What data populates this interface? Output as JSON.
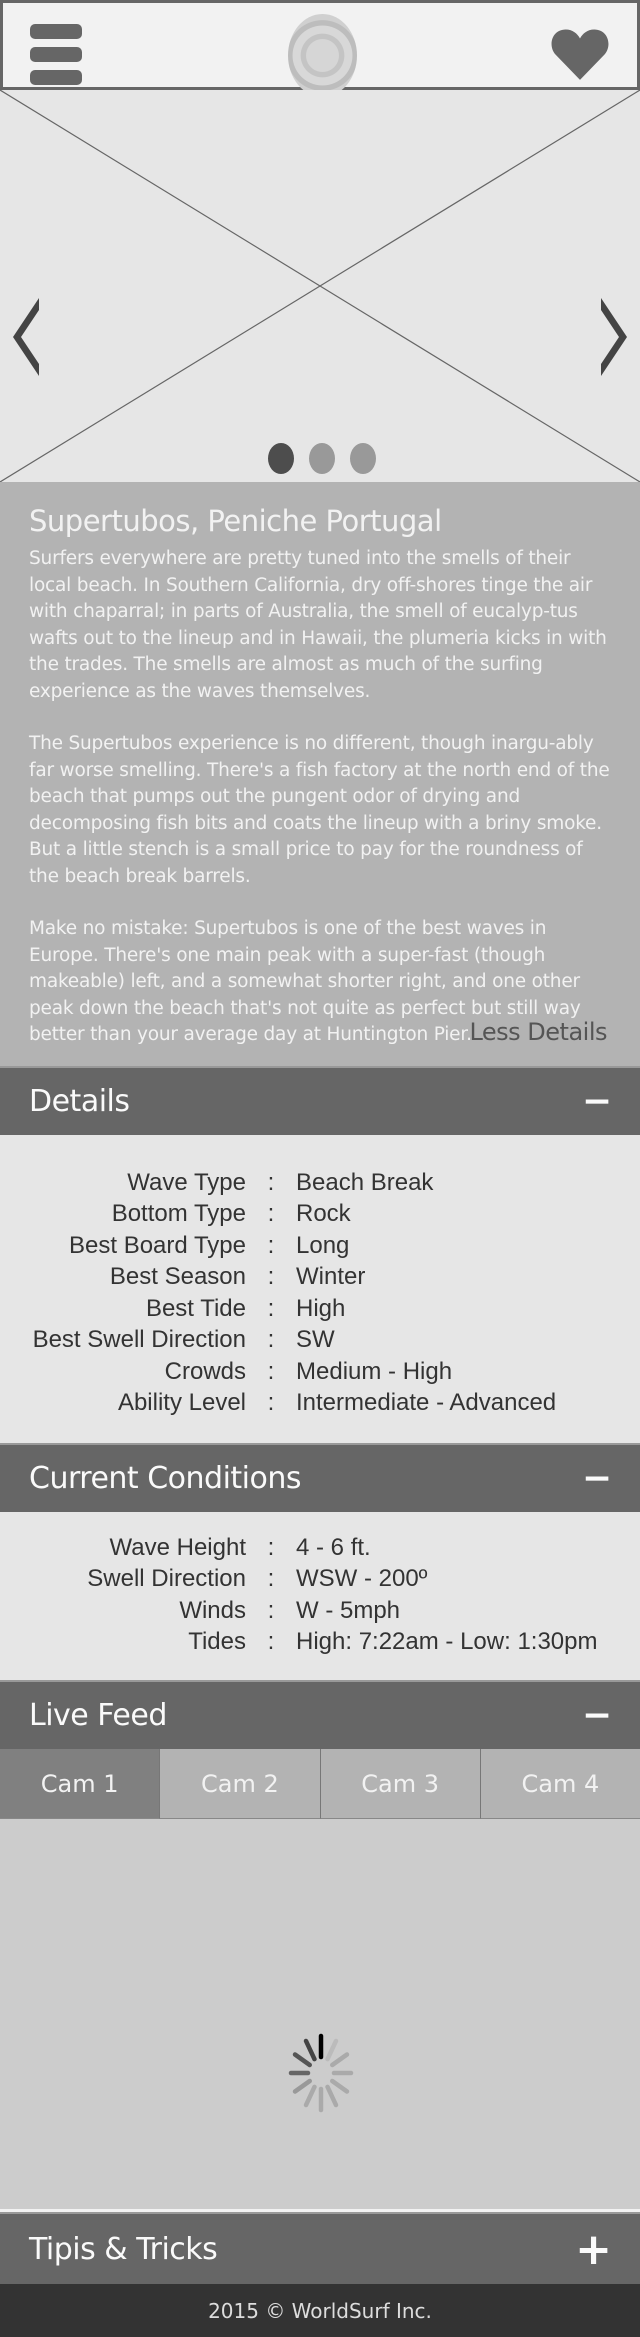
{
  "header": {
    "menu_icon": "hamburger-menu-icon",
    "logo": "wave-logo",
    "favorite_icon": "heart-icon"
  },
  "carousel": {
    "slide_count": 3,
    "active_slide": 1,
    "prev_icon": "chevron-left-icon",
    "next_icon": "chevron-right-icon"
  },
  "spot": {
    "title": "Supertubos, Peniche Portugal",
    "paragraphs": [
      "Surfers everywhere are pretty tuned into the smells of their local beach. In Southern California, dry off-shores tinge the air with chaparral; in parts of Australia, the smell of eucalyp-tus wafts out to the lineup and in Hawaii, the plumeria kicks in with the trades. The smells are almost as much of the surfing experience as the waves themselves.",
      "The Supertubos experience is no different, though inargu-ably far worse smelling. There's a fish factory at the north end of the beach that pumps out the pungent odor of drying and decomposing fish bits and coats the lineup with a briny smoke. But a little stench is a small price to pay for the roundness of the beach break barrels.",
      "Make no mistake: Supertubos is one of the best waves in Europe. There's one main peak with a super-fast (though makeable) left, and a somewhat shorter right, and one other peak down the beach that's not quite as perfect but still way better than your average day at Huntington Pier."
    ],
    "less_details": "Less Details"
  },
  "details": {
    "title": "Details",
    "toggle": "−",
    "separator": ":",
    "rows": [
      {
        "label": "Wave Type",
        "value": "Beach Break"
      },
      {
        "label": "Bottom Type",
        "value": "Rock"
      },
      {
        "label": "Best Board Type",
        "value": "Long"
      },
      {
        "label": "Best Season",
        "value": "Winter"
      },
      {
        "label": "Best Tide",
        "value": "High"
      },
      {
        "label": "Best Swell Direction",
        "value": "SW"
      },
      {
        "label": "Crowds",
        "value": "Medium - High"
      },
      {
        "label": "Ability Level",
        "value": "Intermediate - Advanced"
      }
    ]
  },
  "conditions": {
    "title": "Current Conditions",
    "toggle": "−",
    "separator": ":",
    "rows": [
      {
        "label": "Wave Height",
        "value": "4 - 6 ft."
      },
      {
        "label": "Swell Direction",
        "value": "WSW - 200º"
      },
      {
        "label": "Winds",
        "value": "W - 5mph"
      },
      {
        "label": "Tides",
        "value": "High: 7:22am -  Low: 1:30pm"
      }
    ]
  },
  "live_feed": {
    "title": "Live Feed",
    "toggle": "−",
    "tabs": [
      "Cam 1",
      "Cam 2",
      "Cam 3",
      "Cam 4"
    ],
    "active_tab": 0,
    "loading_icon": "spinner-icon"
  },
  "tips": {
    "title": "Tipis & Tricks",
    "toggle": "+"
  },
  "footer": {
    "text": "2015 © WorldSurf Inc."
  },
  "colors": {
    "header_bg": "#f2f2f2",
    "section_header": "#666666",
    "description_bg": "#b3b3b3",
    "footer_bg": "#333333",
    "active_tab": "#808080"
  }
}
